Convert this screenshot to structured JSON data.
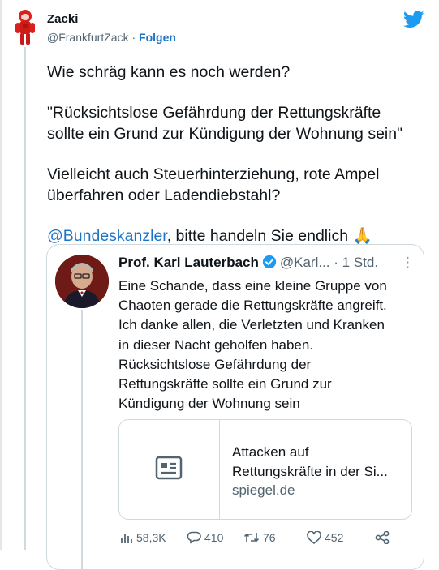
{
  "tweet": {
    "author_name": "Zacki",
    "author_handle": "@FrankfurtZack",
    "separator": " · ",
    "follow_label": "Folgen",
    "lines": [
      "Wie schräg kann es noch werden?",
      "\"Rücksichtslose Gefährdung der Rettungskräfte",
      "sollte ein Grund zur Kündigung der Wohnung sein\"",
      "Vielleicht auch Steuerhinterziehung, rote Ampel",
      "überfahren oder Ladendiebstahl?"
    ],
    "mention": "@Bundeskanzler",
    "closing_text": ", bitte handeln Sie endlich ",
    "emoji": "🙏"
  },
  "quoted": {
    "author_name": "Prof. Karl Lauterbach",
    "author_handle": "@Karl...",
    "time": " · 1 Std.",
    "more": "⋮",
    "text": "Eine Schande, dass eine kleine Gruppe von\nChaoten gerade die Rettungskräfte angreift.\nIch danke allen, die Verletzten und Kranken\nin dieser Nacht geholfen haben.\nRücksichtslose Gefährdung der\nRettungskräfte sollte  ein Grund zur\nKündigung der Wohnung sein",
    "link_title_1": "Attacken auf",
    "link_title_2": "Rettungskräfte in der Si...",
    "link_domain": "spiegel.de",
    "stats": {
      "views": "58,3K",
      "replies": "410",
      "retweets": "76",
      "likes": "452"
    }
  },
  "colors": {
    "link_blue": "#1d74c4",
    "twitter_blue": "#1d9bf0",
    "muted_gray": "#536471",
    "border": "#cfd9de",
    "verified_blue": "#1d9bf0"
  },
  "icons": [
    "hazmat-avatar",
    "twitter-bird-icon",
    "verified-badge-icon",
    "more-icon",
    "article-icon",
    "views-icon",
    "reply-icon",
    "retweet-icon",
    "like-icon",
    "share-icon"
  ]
}
